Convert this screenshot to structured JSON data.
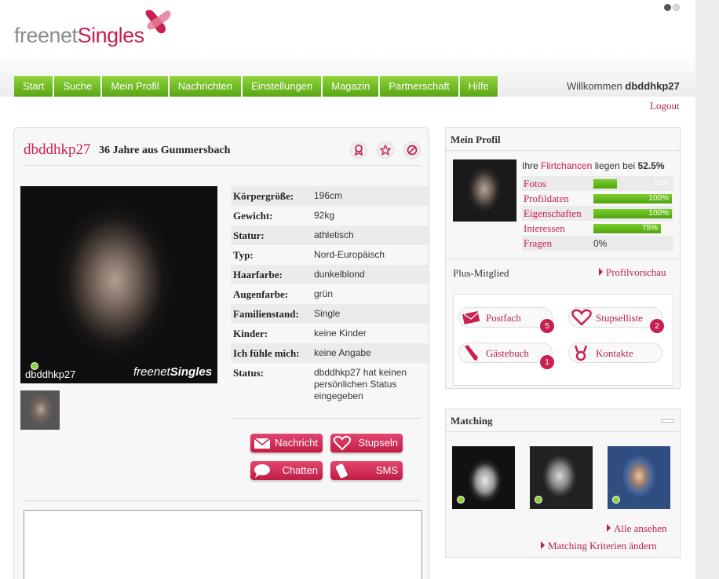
{
  "brand": {
    "part1": "freenet",
    "part2": "Singles",
    "accent": "#c8214f",
    "nav_color": "#6cb820"
  },
  "nav": [
    "Start",
    "Suche",
    "Mein Profil",
    "Nachrichten",
    "Einstellungen",
    "Magazin",
    "Partnerschaft",
    "Hilfe"
  ],
  "welcome": {
    "prefix": "Willkommen",
    "user": "dbddhkp27"
  },
  "logout": "Logout",
  "profile": {
    "username": "dbddhkp27",
    "subtitle": "36 Jahre aus Gummersbach",
    "photo_user": "dbddhkp27",
    "photo_brand1": "freenet",
    "photo_brand2": "Singles",
    "icons": [
      "badge-icon",
      "star-icon",
      "block-icon"
    ],
    "details": [
      {
        "label": "Körpergröße:",
        "value": "196cm"
      },
      {
        "label": "Gewicht:",
        "value": "92kg"
      },
      {
        "label": "Statur:",
        "value": "athletisch"
      },
      {
        "label": "Typ:",
        "value": "Nord-Europäisch"
      },
      {
        "label": "Haarfarbe:",
        "value": "dunkelblond"
      },
      {
        "label": "Augenfarbe:",
        "value": "grün"
      },
      {
        "label": "Familienstand:",
        "value": "Single"
      },
      {
        "label": "Kinder:",
        "value": "keine Kinder"
      },
      {
        "label": "Ich fühle mich:",
        "value": "keine Angabe"
      },
      {
        "label": "Status:",
        "value": "dbddhkp27 hat keinen persönlichen Status eingegeben"
      }
    ],
    "buttons": {
      "message": "Nachricht",
      "stupsen": "Stupseln",
      "chat": "Chatten",
      "sms": "SMS"
    }
  },
  "mein_profil": {
    "title": "Mein Profil",
    "flirt_prefix": "Ihre",
    "flirt_link": "Flirtchancen",
    "flirt_mid": "liegen bei",
    "flirt_value": "52.5%",
    "stats": [
      {
        "label": "Fotos",
        "pct": 10,
        "text": "10%"
      },
      {
        "label": "Profildaten",
        "pct": 100,
        "text": "100%"
      },
      {
        "label": "Eigenschaften",
        "pct": 100,
        "text": "100%"
      },
      {
        "label": "Interessen",
        "pct": 75,
        "text": "75%"
      },
      {
        "label": "Fragen",
        "pct": 0,
        "text": "0%"
      }
    ],
    "membership": "Plus-Mitglied",
    "preview": "Profilvorschau",
    "quick": {
      "postfach": {
        "label": "Postfach",
        "count": "5"
      },
      "stupselliste": {
        "label": "Stupselliste",
        "count": "2"
      },
      "gaestebuch": {
        "label": "Gästebuch",
        "count": "1"
      },
      "kontakte": {
        "label": "Kontakte"
      }
    }
  },
  "matching": {
    "title": "Matching",
    "see_all": "Alle ansehen",
    "change_criteria": "Matching Kriterien ändern"
  }
}
